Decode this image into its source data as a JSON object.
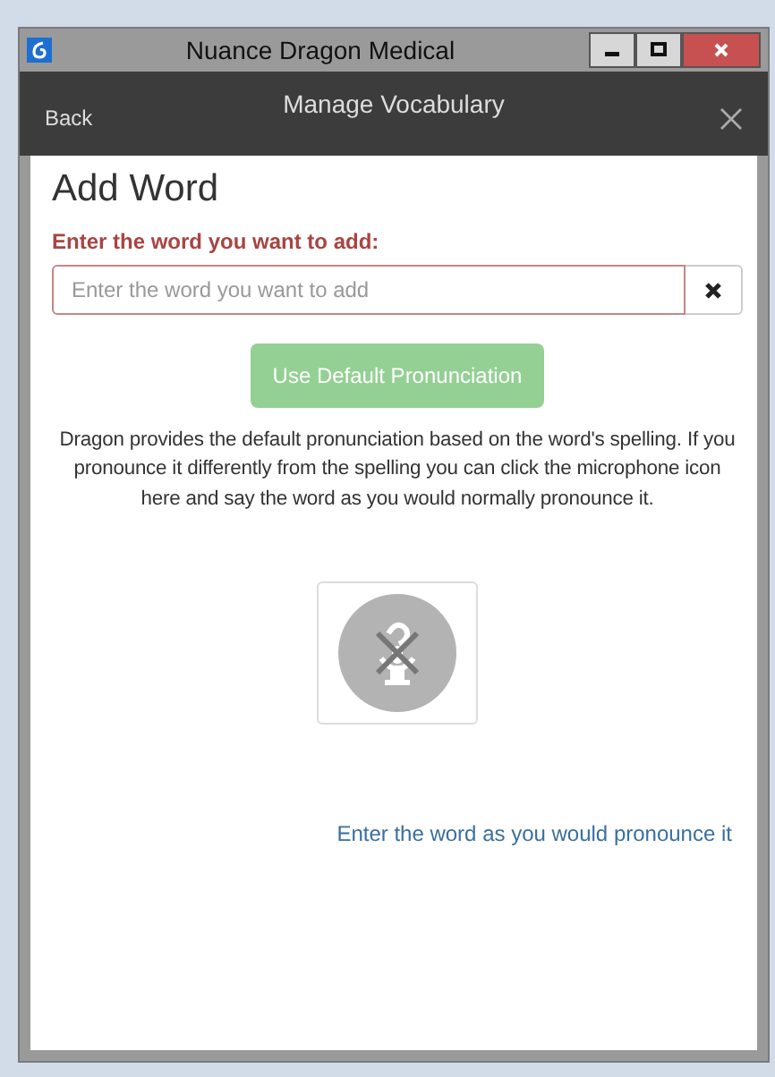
{
  "window": {
    "title": "Nuance Dragon Medical"
  },
  "header": {
    "back": "Back",
    "title": "Manage Vocabulary"
  },
  "page": {
    "heading": "Add Word",
    "field_label": "Enter the word you want to add:",
    "field": {
      "placeholder": "Enter the word you want to add"
    },
    "default_button": {
      "label": "Use Default Pronunciation",
      "disabled": true
    },
    "description": "Dragon provides the default pronunciation based on the word's spelling. If you pronounce it differently from the spelling you can click the microphone icon here and say the word as you would normally pronounce it.",
    "microphone": {
      "disabled": true
    },
    "hint": "Enter the word as you would pronounce it"
  }
}
